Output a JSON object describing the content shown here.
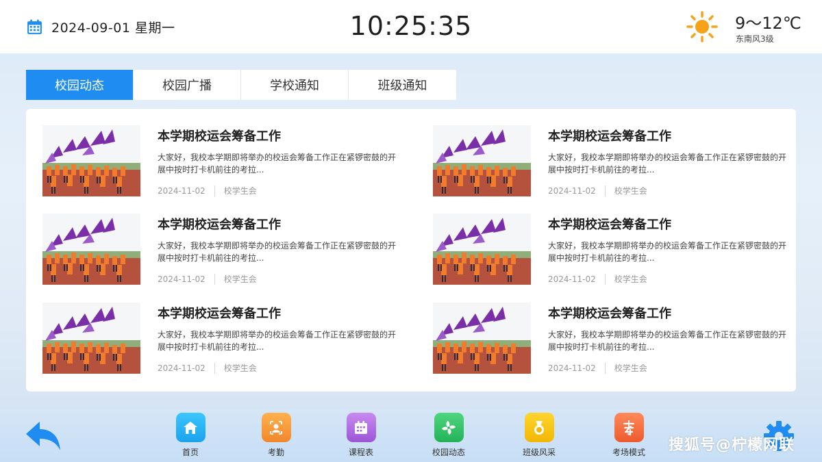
{
  "header": {
    "date": "2024-09-01 星期一",
    "time": "10:25:35",
    "temperature": "9～12℃",
    "wind": "东南风3级"
  },
  "tabs": [
    {
      "label": "校园动态",
      "active": true
    },
    {
      "label": "校园广播",
      "active": false
    },
    {
      "label": "学校通知",
      "active": false
    },
    {
      "label": "班级通知",
      "active": false
    }
  ],
  "news": [
    {
      "title": "本学期校运会筹备工作",
      "desc": "大家好，我校本学期即将举办的校运会筹备工作正在紧锣密鼓的开展中按时打卡机前往的考拉...",
      "date": "2024-11-02",
      "source": "校学生会"
    },
    {
      "title": "本学期校运会筹备工作",
      "desc": "大家好，我校本学期即将举办的校运会筹备工作正在紧锣密鼓的开展中按时打卡机前往的考拉...",
      "date": "2024-11-02",
      "source": "校学生会"
    },
    {
      "title": "本学期校运会筹备工作",
      "desc": "大家好，我校本学期即将举办的校运会筹备工作正在紧锣密鼓的开展中按时打卡机前往的考拉...",
      "date": "2024-11-02",
      "source": "校学生会"
    },
    {
      "title": "本学期校运会筹备工作",
      "desc": "大家好，我校本学期即将举办的校运会筹备工作正在紧锣密鼓的开展中按时打卡机前往的考拉...",
      "date": "2024-11-02",
      "source": "校学生会"
    },
    {
      "title": "本学期校运会筹备工作",
      "desc": "大家好，我校本学期即将举办的校运会筹备工作正在紧锣密鼓的开展中按时打卡机前往的考拉...",
      "date": "2024-11-02",
      "source": "校学生会"
    },
    {
      "title": "本学期校运会筹备工作",
      "desc": "大家好，我校本学期即将举办的校运会筹备工作正在紧锣密鼓的开展中按时打卡机前往的考拉...",
      "date": "2024-11-02",
      "source": "校学生会"
    }
  ],
  "dock": [
    {
      "label": "首页",
      "icon": "home-icon",
      "color": "#27b6f5"
    },
    {
      "label": "考勤",
      "icon": "attendance-icon",
      "color": "#f7993a"
    },
    {
      "label": "课程表",
      "icon": "calendar-icon",
      "color": "#b06be0"
    },
    {
      "label": "校园动态",
      "icon": "pinwheel-icon",
      "color": "#36c46a"
    },
    {
      "label": "班级风采",
      "icon": "medal-icon",
      "color": "#f7c514"
    },
    {
      "label": "考场模式",
      "icon": "exam-icon",
      "color": "#f26a3e"
    }
  ],
  "watermark": "搜狐号@柠檬网联",
  "colors": {
    "accent": "#1e8cf0",
    "background": "#dfeaf6"
  }
}
